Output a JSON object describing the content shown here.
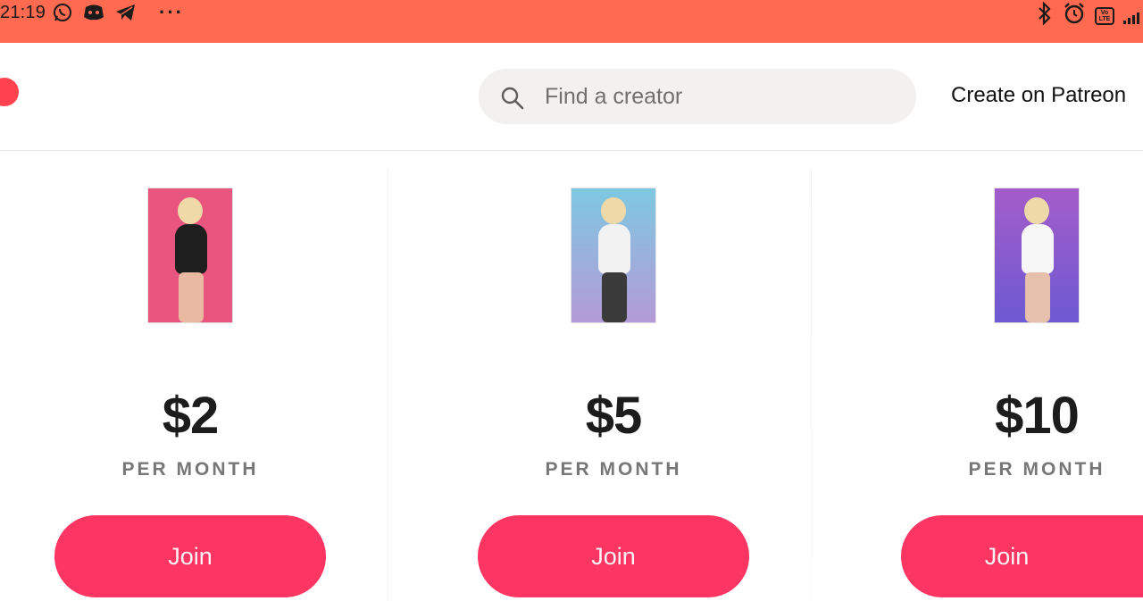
{
  "status_bar": {
    "time": "21:19",
    "left_icons": [
      "whatsapp-icon",
      "discord-icon",
      "telegram-icon"
    ],
    "more_indicator": "···",
    "right_icons": [
      "bluetooth-icon",
      "alarm-icon",
      "volte-icon",
      "signal-icon"
    ],
    "volte_label": "Vo LTE",
    "background_color": "#ff6a50"
  },
  "header": {
    "logo_color": "#ff424d",
    "search": {
      "placeholder": "Find a creator",
      "value": ""
    },
    "create_link": "Create on Patreon"
  },
  "tiers": [
    {
      "price": "$2",
      "period": "PER MONTH",
      "join_label": "Join",
      "image_bg": "#e8557f"
    },
    {
      "price": "$5",
      "period": "PER MONTH",
      "join_label": "Join",
      "image_bg": "#7fb7d8"
    },
    {
      "price": "$10",
      "period": "PER MONTH",
      "join_label": "Join",
      "image_bg": "#8b5ed0"
    }
  ],
  "colors": {
    "join_button": "#fc3562",
    "accent": "#ff424d"
  }
}
